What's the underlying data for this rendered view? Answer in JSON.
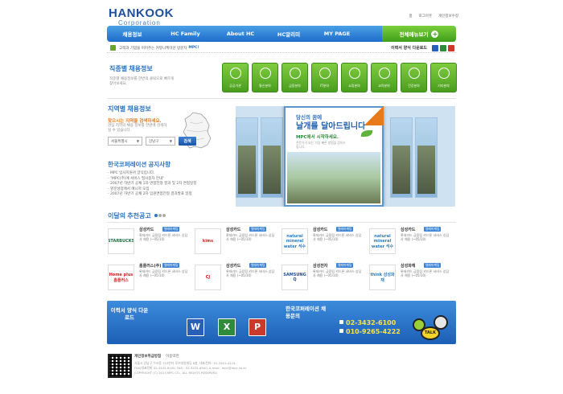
{
  "logo": {
    "line1": "HANKOOK",
    "line2": "Corporation"
  },
  "top_links": [
    "홈",
    "로그아웃",
    "개인정보수정"
  ],
  "nav": {
    "items": [
      "채용정보",
      "HC Family",
      "About HC",
      "HC알리미",
      "MY PAGE"
    ],
    "all_menu": "전체메뉴보기"
  },
  "notice": {
    "text": "고객과 기업을 이어주는 커뮤니케이션 방문자",
    "highlight": "MPC!",
    "download_label": "이력서 양식 다운로드"
  },
  "job_info": {
    "title": "직종별 채용정보",
    "desc": "직종별 채용정보를 한번의 클릭으로 빠르게 찾아보세요."
  },
  "categories": [
    {
      "label": "공공기관",
      "icon": "building-icon"
    },
    {
      "label": "통신분야",
      "icon": "phone-icon"
    },
    {
      "label": "금융분야",
      "icon": "piggy-bank-icon"
    },
    {
      "label": "IT분야",
      "icon": "bulb-icon"
    },
    {
      "label": "쇼핑분야",
      "icon": "cart-icon"
    },
    {
      "label": "교육분야",
      "icon": "book-icon"
    },
    {
      "label": "건강분야",
      "icon": "health-icon"
    },
    {
      "label": "기타분야",
      "icon": "more-icon"
    }
  ],
  "region": {
    "title": "지역별 채용정보",
    "question": "찾으시는 지역을 검색하세요.",
    "desc": "관심 지역의 채용 정보를 한번에 검색하실 수 있습니다.",
    "select1": "서울특별시",
    "select2": "강남구",
    "search_label": "검색"
  },
  "announcements": {
    "title": "한국코퍼레이션 공지사항",
    "items": [
      "- MPC 입사지원서 양식입니다.",
      "- \"MPC(주)에 서비스 필사중자 안내\"",
      "- 2007년 하반기 공채 1차 면접전형 결과 및 2차 면접일정",
      "- 영문성업에서 매니저 모집",
      "- 2007년 하반기 공채 2차 임원면접전형 결과발표 일정"
    ]
  },
  "banner": {
    "line1": "당신의 꿈에",
    "line2": "날개를 달아드립니다",
    "line3": "MPC에서 시작하세요.",
    "line4": "전문가가 되는 가장 빠른 방법을 찾아드립니다."
  },
  "recommend": {
    "title": "이달의 추천공고",
    "cards": [
      {
        "logo": "STARBUCKS",
        "logo_color": "#1e6e43",
        "company": "삼성카드",
        "tag": "텔레마케팅",
        "desc": "롯데카드 금융팀 카드론 서비스 상담사 채용 (~05/10)"
      },
      {
        "logo": "kims",
        "logo_color": "#d21f1f",
        "company": "삼성카드",
        "tag": "텔레마케팅",
        "desc": "롯데카드 금융팀 카드론 서비스 상담사 채용 (~05/10)"
      },
      {
        "logo": "natural mineral water 석수",
        "logo_color": "#2a7cc8",
        "company": "삼성카드",
        "tag": "텔레마케팅",
        "desc": "롯데카드 금융팀 카드론 서비스 상담사 채용 (~05/10)"
      },
      {
        "logo": "natural mineral water 석수",
        "logo_color": "#2a7cc8",
        "company": "삼성카드",
        "tag": "텔레마케팅",
        "desc": "롯데카드 금융팀 카드론 서비스 상담사 채용 (~05/10)"
      },
      {
        "logo": "Home plus 홈플러스",
        "logo_color": "#d21f1f",
        "company": "홈플러스(주)",
        "tag": "텔레마케팅",
        "desc": "롯데카드 금융팀 카드론 서비스 상담사 채용 (~05/10)"
      },
      {
        "logo": "CJ",
        "logo_color": "#d21f1f",
        "company": "삼성카드",
        "tag": "텔레마케팅",
        "desc": "롯데카드 금융팀 카드론 서비스 상담사 채용 (~05/10)"
      },
      {
        "logo": "SAMSUNG Q",
        "logo_color": "#1d4f9e",
        "company": "삼성전자",
        "tag": "텔레마케팅",
        "desc": "롯데카드 금융팀 카드론 서비스 상담사 채용 (~05/10)"
      },
      {
        "logo": "think 삼성화재",
        "logo_color": "#2a7cc8",
        "company": "삼성화재",
        "tag": "텔레마케팅",
        "desc": "롯데카드 금융팀 카드론 서비스 상담사 채용 (~05/10)"
      }
    ]
  },
  "download_bar": {
    "title": "이력서 양식 다운로드",
    "doc_icons": [
      "W",
      "X",
      "P"
    ],
    "contact_title": "한국코퍼레이션 채용문의",
    "phone1": "02-3432-6100",
    "phone2": "010-9265-4222",
    "bubble_label": "TALK"
  },
  "footer": {
    "links": [
      "개인정보취급방침",
      "이용약관"
    ],
    "address": "서울시 강남구 수서동 724번지 로즈데일빌딩 6층, 대표전화 : 02-3401-4114,",
    "contact": "FAX(대표전화 02-3432-6100, FAX : 02-3432-6500, e-mail : mpc@mpc.co.kr",
    "copyright": "COPYRIGHT (C) 2013 MPC CO., ALL RIGHTS RESERVED"
  }
}
